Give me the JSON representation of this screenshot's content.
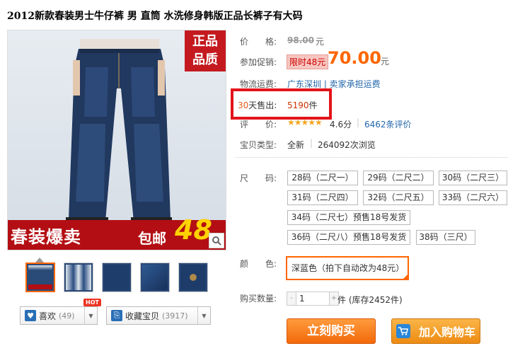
{
  "product": {
    "title": "2012新款春装男士牛仔裤 男 直筒 水洗修身韩版正品长裤子有大码"
  },
  "image": {
    "badge_line1": "正品",
    "badge_line2": "品质",
    "banner_left": "春装爆卖",
    "banner_mid": "包邮",
    "banner_num": "48",
    "thumb_count": 5
  },
  "actions": {
    "like_label": "喜欢",
    "like_count": "(49)",
    "hot_tag": "HOT",
    "fav_label": "收藏宝贝",
    "fav_count": "(3917)"
  },
  "price": {
    "label": "价　　格:",
    "original": "98.00",
    "unit": "元"
  },
  "promo": {
    "label": "参加促销:",
    "tag": "限时48元",
    "price": "70.00",
    "unit": "元"
  },
  "shipping": {
    "label": "物流运费:",
    "text": "广东深圳 | 卖家承担运费"
  },
  "sold": {
    "days": "30",
    "label_rest": "天售出:",
    "count": "5190",
    "unit": "件"
  },
  "rating": {
    "label": "评　　价:",
    "stars": "★★★★★",
    "score": "4.6分",
    "sep": "|",
    "reviews": "6462条评价"
  },
  "condition": {
    "label": "宝贝类型:",
    "value": "全新",
    "sep": "|",
    "views": "264092次浏览"
  },
  "size": {
    "label": "尺　　码:",
    "options": [
      "28码（二尺一）",
      "29码（二尺二）",
      "30码（二尺三）",
      "31码（二尺四）",
      "32码（二尺五）",
      "33码（二尺六）",
      "34码（二尺七）预售18号发货",
      "36码（二尺八）预售18号发货",
      "38码（三尺）"
    ]
  },
  "color": {
    "label": "颜　　色:",
    "selected": "深蓝色（拍下自动改为48元）"
  },
  "quantity": {
    "label": "购买数量:",
    "value": "1",
    "minus": "-",
    "plus": "+",
    "unit_text": "件 (库存2452件)"
  },
  "buttons": {
    "buy_now": "立刻购买",
    "add_cart": "加入购物车"
  },
  "colors": {
    "accent_orange": "#f60",
    "sold_box_red": "#e2141a",
    "banner_red": "#b30e13",
    "link_blue": "#2266aa"
  }
}
